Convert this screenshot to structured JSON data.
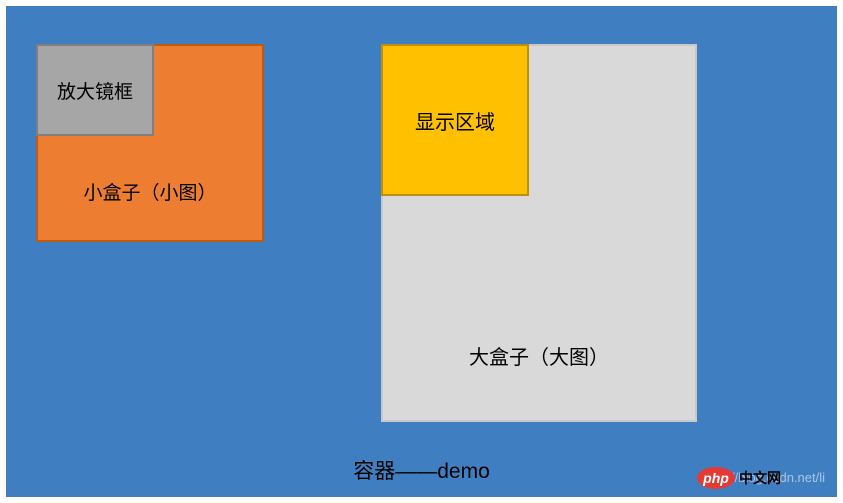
{
  "container": {
    "label": "容器——demo",
    "bgColor": "#3f7fc1"
  },
  "smallBox": {
    "label": "小盒子（小图）",
    "bgColor": "#ed7d31",
    "magnifier": {
      "label": "放大镜框",
      "bgColor": "#a6a6a6"
    }
  },
  "bigBox": {
    "label": "大盒子（大图）",
    "bgColor": "#d9d9d9",
    "displayArea": {
      "label": "显示区域",
      "bgColor": "#ffc000"
    }
  },
  "watermark": {
    "url": "http://blog.csdn.net/li",
    "badgePhp": "php",
    "badgeText": "中文网"
  }
}
